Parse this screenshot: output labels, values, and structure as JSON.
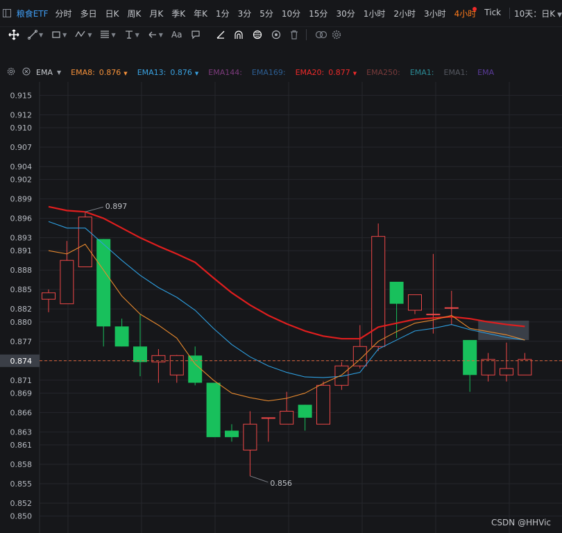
{
  "header": {
    "symbol": "粮食ETF",
    "periods": [
      "分时",
      "多日",
      "日K",
      "周K",
      "月K",
      "季K",
      "年K",
      "1分",
      "3分",
      "5分",
      "10分",
      "15分",
      "30分",
      "1小时",
      "2小时",
      "3小时",
      "4小时",
      "Tick"
    ],
    "active_period": "4小时",
    "mode": "10天：日K"
  },
  "toolbar": {
    "tools": [
      "move-icon",
      "line-icon",
      "shape-icon",
      "pattern-icon",
      "fib-icon",
      "measure-icon",
      "arrow-icon",
      "text-icon",
      "comment-icon",
      "angle-icon",
      "arc-icon",
      "cycle-icon",
      "target-icon",
      "delete-icon",
      "visibility-icon",
      "settings-icon"
    ],
    "text_tool_label": "Aa"
  },
  "legend": {
    "indicator": "EMA",
    "items": [
      {
        "label": "EMA8:",
        "value": "0.876",
        "color": "#f7923a",
        "arrow": "▼"
      },
      {
        "label": "EMA13:",
        "value": "0.876",
        "color": "#3aa3e3",
        "arrow": "▼"
      },
      {
        "label": "EMA144:",
        "value": "",
        "color": "#7d3b7d",
        "arrow": ""
      },
      {
        "label": "EMA169:",
        "value": "",
        "color": "#2d5f94",
        "arrow": ""
      },
      {
        "label": "EMA20:",
        "value": "0.877",
        "color": "#f02a2a",
        "arrow": "▼"
      },
      {
        "label": "EMA250:",
        "value": "",
        "color": "#7a3b3b",
        "arrow": ""
      },
      {
        "label": "EMA1:",
        "value": "",
        "color": "#2b8a95",
        "arrow": ""
      },
      {
        "label": "EMA1:",
        "value": "",
        "color": "#555860",
        "arrow": ""
      },
      {
        "label": "EMA",
        "value": "",
        "color": "#5b3b9a",
        "arrow": ""
      }
    ]
  },
  "watermark": "CSDN @HHVic",
  "chart_data": {
    "type": "candlestick",
    "ylim": [
      0.849,
      0.916
    ],
    "y_ticks": [
      "0.915",
      "0.912",
      "0.910",
      "0.907",
      "0.904",
      "0.902",
      "0.899",
      "0.896",
      "0.893",
      "0.891",
      "0.888",
      "0.885",
      "0.882",
      "0.880",
      "0.877",
      "0.874",
      "0.871",
      "0.869",
      "0.866",
      "0.863",
      "0.861",
      "0.858",
      "0.855",
      "0.852",
      "0.850"
    ],
    "current_price": "0.874",
    "max_label": "0.897",
    "min_label": "0.856",
    "colors": {
      "up": "#f04848",
      "down": "#18c05c",
      "ema8": "#e98a2e",
      "ema13": "#2e9fe0",
      "ema20": "#e01e1e",
      "grid": "#25272c",
      "price_line": "#e0663c"
    },
    "candles": [
      {
        "o": 0.8835,
        "h": 0.885,
        "l": 0.8815,
        "c": 0.8845
      },
      {
        "o": 0.8828,
        "h": 0.8925,
        "l": 0.8828,
        "c": 0.8895
      },
      {
        "o": 0.8885,
        "h": 0.897,
        "l": 0.8885,
        "c": 0.8962
      },
      {
        "o": 0.8928,
        "h": 0.8928,
        "l": 0.8762,
        "c": 0.8793
      },
      {
        "o": 0.8793,
        "h": 0.8805,
        "l": 0.8762,
        "c": 0.8762
      },
      {
        "o": 0.8762,
        "h": 0.8812,
        "l": 0.8716,
        "c": 0.8738
      },
      {
        "o": 0.8738,
        "h": 0.8758,
        "l": 0.8706,
        "c": 0.8748
      },
      {
        "o": 0.8718,
        "h": 0.8749,
        "l": 0.8706,
        "c": 0.8748
      },
      {
        "o": 0.8748,
        "h": 0.8762,
        "l": 0.8702,
        "c": 0.8706
      },
      {
        "o": 0.8706,
        "h": 0.8706,
        "l": 0.8622,
        "c": 0.8622
      },
      {
        "o": 0.8632,
        "h": 0.8642,
        "l": 0.8615,
        "c": 0.8622
      },
      {
        "o": 0.8602,
        "h": 0.8662,
        "l": 0.8562,
        "c": 0.8642
      },
      {
        "o": 0.8652,
        "h": 0.8652,
        "l": 0.8615,
        "c": 0.8652
      },
      {
        "o": 0.8642,
        "h": 0.8692,
        "l": 0.8642,
        "c": 0.8662
      },
      {
        "o": 0.8672,
        "h": 0.8672,
        "l": 0.8632,
        "c": 0.8652
      },
      {
        "o": 0.8642,
        "h": 0.8708,
        "l": 0.8642,
        "c": 0.8702
      },
      {
        "o": 0.8702,
        "h": 0.8738,
        "l": 0.8695,
        "c": 0.8732
      },
      {
        "o": 0.8732,
        "h": 0.8795,
        "l": 0.8728,
        "c": 0.8762
      },
      {
        "o": 0.8762,
        "h": 0.8952,
        "l": 0.8755,
        "c": 0.8932
      },
      {
        "o": 0.8862,
        "h": 0.8862,
        "l": 0.8775,
        "c": 0.8828
      },
      {
        "o": 0.8818,
        "h": 0.8842,
        "l": 0.8812,
        "c": 0.8842
      },
      {
        "o": 0.8812,
        "h": 0.8905,
        "l": 0.8782,
        "c": 0.8812
      },
      {
        "o": 0.8822,
        "h": 0.8848,
        "l": 0.8795,
        "c": 0.8822
      },
      {
        "o": 0.8772,
        "h": 0.8772,
        "l": 0.8692,
        "c": 0.8718
      },
      {
        "o": 0.8718,
        "h": 0.8752,
        "l": 0.8708,
        "c": 0.8742
      },
      {
        "o": 0.8718,
        "h": 0.8768,
        "l": 0.8708,
        "c": 0.8728
      },
      {
        "o": 0.8718,
        "h": 0.8752,
        "l": 0.8718,
        "c": 0.8742
      }
    ],
    "series": [
      {
        "name": "EMA20",
        "values": [
          0.8978,
          0.8972,
          0.897,
          0.896,
          0.8945,
          0.893,
          0.8917,
          0.8905,
          0.8892,
          0.8868,
          0.8845,
          0.8826,
          0.881,
          0.8797,
          0.8786,
          0.8778,
          0.8774,
          0.8774,
          0.8792,
          0.8798,
          0.8804,
          0.8806,
          0.8808,
          0.8805,
          0.88,
          0.8796,
          0.8793
        ]
      },
      {
        "name": "EMA13",
        "values": [
          0.8955,
          0.8945,
          0.8945,
          0.892,
          0.8895,
          0.8872,
          0.8853,
          0.8838,
          0.8818,
          0.879,
          0.8765,
          0.8746,
          0.8732,
          0.8722,
          0.8715,
          0.8714,
          0.8716,
          0.8722,
          0.8758,
          0.8772,
          0.8786,
          0.879,
          0.8796,
          0.8788,
          0.8782,
          0.8776,
          0.8772
        ]
      },
      {
        "name": "EMA8",
        "values": [
          0.891,
          0.8905,
          0.892,
          0.888,
          0.884,
          0.8812,
          0.8795,
          0.8775,
          0.8735,
          0.871,
          0.869,
          0.8683,
          0.8678,
          0.8682,
          0.869,
          0.8705,
          0.8718,
          0.8742,
          0.877,
          0.8785,
          0.8798,
          0.8803,
          0.881,
          0.879,
          0.8785,
          0.878,
          0.8772
        ]
      }
    ],
    "highlight_box": {
      "x_start": 23,
      "x_end": 26,
      "y_low": 0.8772,
      "y_high": 0.8802
    }
  }
}
